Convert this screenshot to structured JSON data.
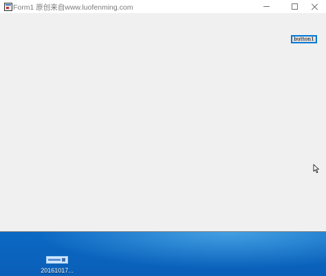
{
  "window": {
    "title": "Form1  原创来自www.luofenming.com",
    "controls": {
      "minimize": "minimize",
      "maximize": "maximize",
      "close": "close"
    }
  },
  "form": {
    "button_label": "button1"
  },
  "desktop": {
    "icon_label": "20161017...",
    "icon_name": "image-file-icon"
  },
  "colors": {
    "form_background": "#f0f0f0",
    "titlebar_background": "#ffffff",
    "button_focus_border": "#0078d7",
    "desktop_blue": "#0d7ad8"
  }
}
